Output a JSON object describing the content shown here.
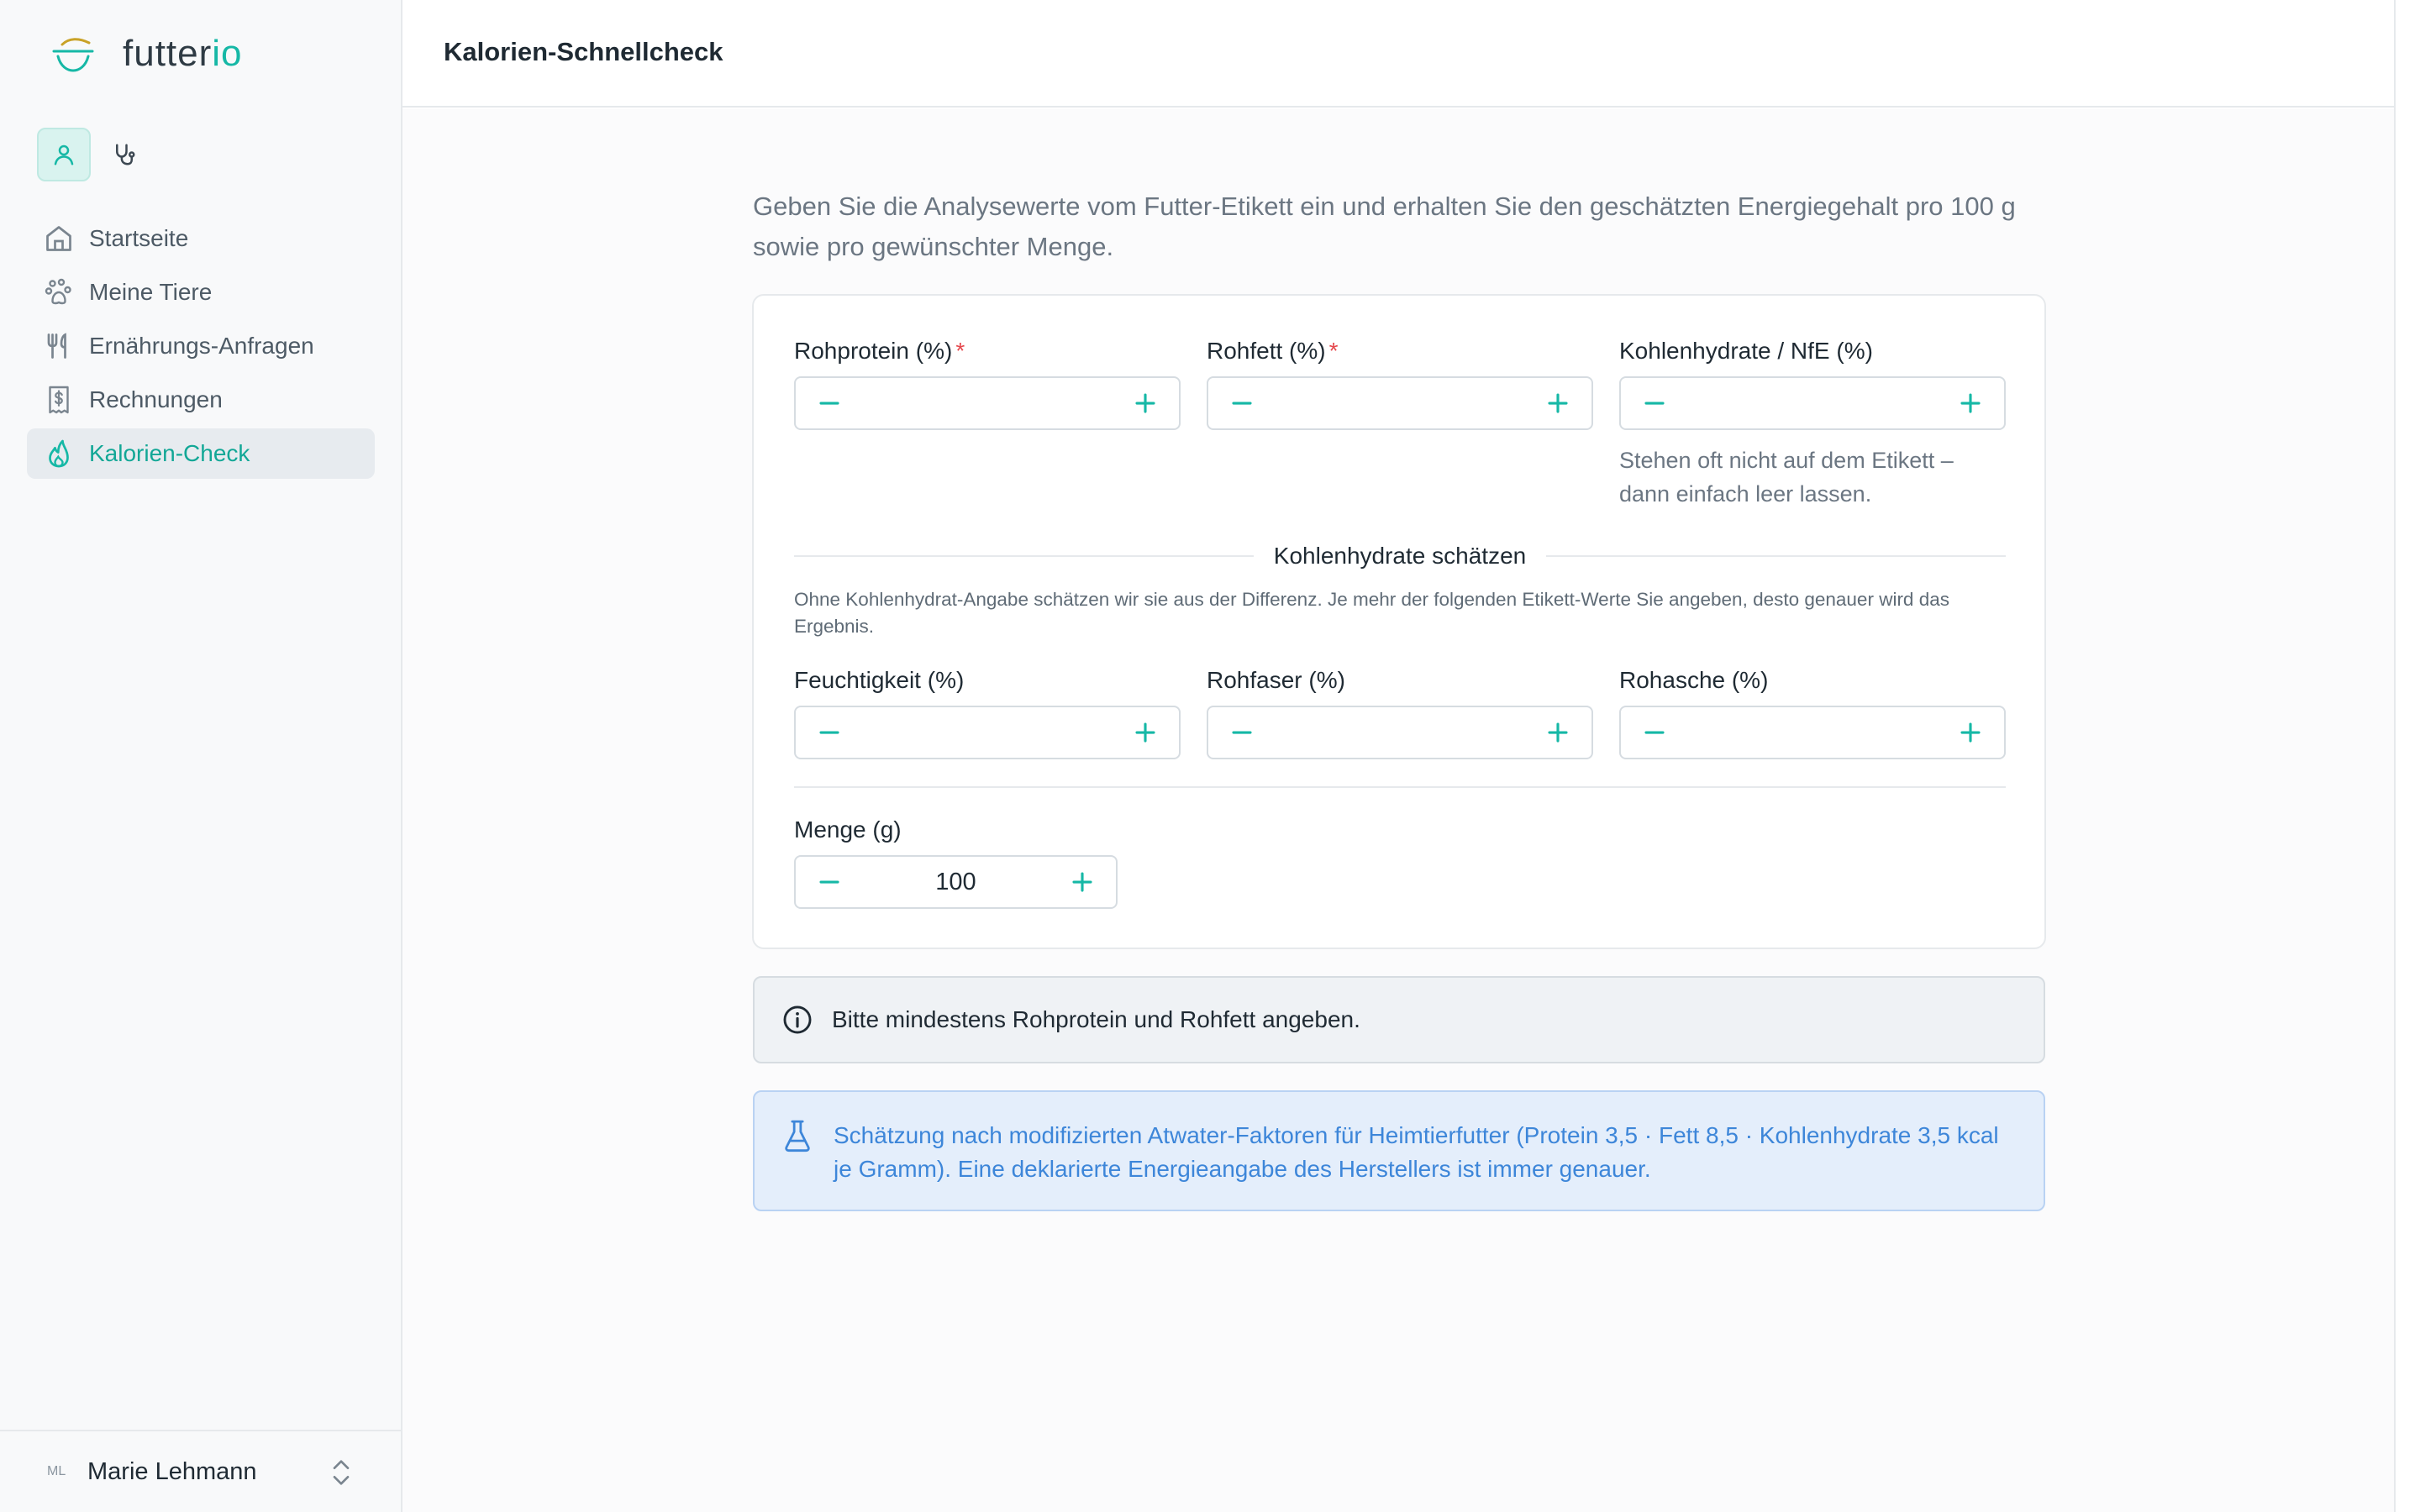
{
  "brand": {
    "name_main": "futter",
    "name_accent": "io"
  },
  "colors": {
    "accent": "#16b8a6",
    "info_text": "#3d86d9",
    "required": "#e5484d"
  },
  "mode_switch": [
    {
      "icon": "user-icon",
      "active": true
    },
    {
      "icon": "stethoscope-icon",
      "active": false
    }
  ],
  "sidebar": {
    "items": [
      {
        "label": "Startseite",
        "icon": "home-icon"
      },
      {
        "label": "Meine Tiere",
        "icon": "paw-icon"
      },
      {
        "label": "Ernährungs-Anfragen",
        "icon": "utensils-icon"
      },
      {
        "label": "Rechnungen",
        "icon": "receipt-icon"
      },
      {
        "label": "Kalorien-Check",
        "icon": "flame-icon",
        "active": true
      }
    ]
  },
  "user": {
    "initials": "ML",
    "name": "Marie Lehmann"
  },
  "header": {
    "title": "Kalorien-Schnellcheck"
  },
  "main": {
    "intro": "Geben Sie die Analysewerte vom Futter-Etikett ein und erhalten Sie den geschätzten Energiegehalt pro 100 g sowie pro gewünschter Menge.",
    "fields": {
      "protein": {
        "label": "Rohprotein (%)",
        "required_mark": "*",
        "value": ""
      },
      "fat": {
        "label": "Rohfett (%)",
        "required_mark": "*",
        "value": ""
      },
      "carbs": {
        "label": "Kohlenhydrate / NfE (%)",
        "value": "",
        "hint": "Stehen oft nicht auf dem Etikett – dann einfach leer lassen."
      },
      "moisture": {
        "label": "Feuchtigkeit (%)",
        "value": ""
      },
      "fiber": {
        "label": "Rohfaser (%)",
        "value": ""
      },
      "ash": {
        "label": "Rohasche (%)",
        "value": ""
      },
      "amount": {
        "label": "Menge (g)",
        "value": "100"
      }
    },
    "estimate_section": {
      "title": "Kohlenhydrate schätzen",
      "note": "Ohne Kohlenhydrat-Angabe schätzen wir sie aus der Differenz. Je mehr der folgenden Etikett-Werte Sie angeben, desto genauer wird das Ergebnis."
    },
    "alert": {
      "icon": "info-icon",
      "text": "Bitte mindestens Rohprotein und Rohfett angeben."
    },
    "info": {
      "icon": "flask-icon",
      "text": "Schätzung nach modifizierten Atwater-Faktoren für Heimtierfutter (Protein 3,5 · Fett 8,5 · Kohlenhydrate 3,5 kcal je Gramm). Eine deklarierte Energieangabe des Herstellers ist immer genauer."
    }
  }
}
